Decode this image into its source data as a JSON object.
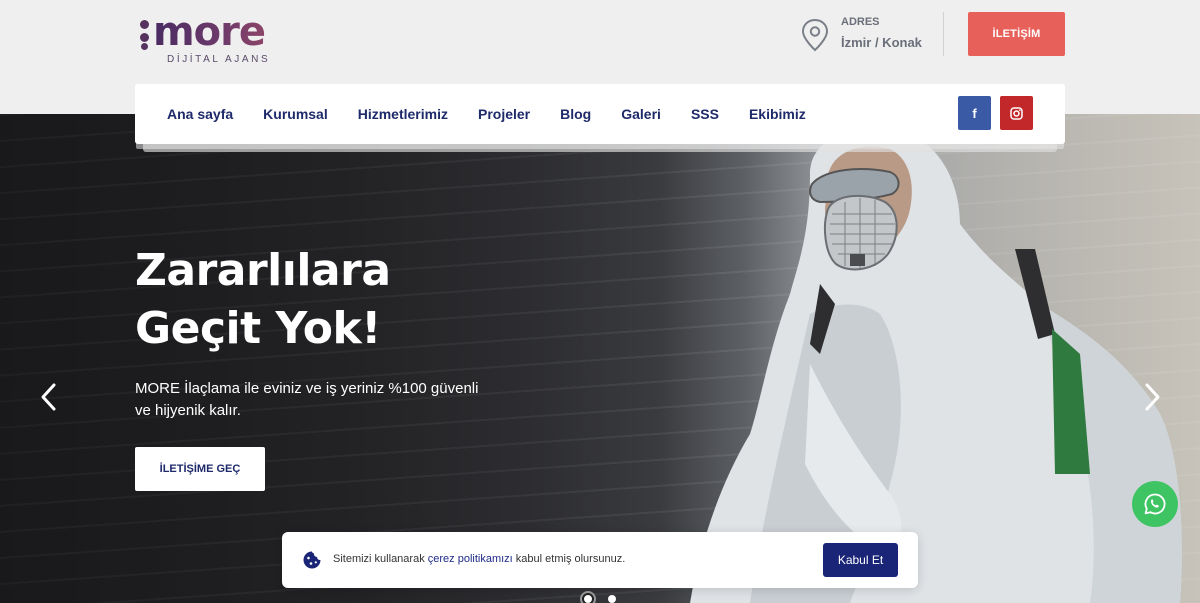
{
  "brand": {
    "name": "more",
    "tagline": "DİJİTAL AJANS"
  },
  "header": {
    "address_label": "ADRES",
    "address_value": "İzmir / Konak",
    "contact_button": "İLETİŞİM"
  },
  "nav": {
    "items": [
      {
        "label": "Ana sayfa"
      },
      {
        "label": "Kurumsal"
      },
      {
        "label": "Hizmetlerimiz"
      },
      {
        "label": "Projeler"
      },
      {
        "label": "Blog"
      },
      {
        "label": "Galeri"
      },
      {
        "label": "SSS"
      },
      {
        "label": "Ekibimiz"
      }
    ],
    "social": [
      {
        "icon": "facebook-icon",
        "glyph": "f"
      },
      {
        "icon": "instagram-icon"
      }
    ]
  },
  "hero": {
    "title_line1": "Zararlılara",
    "title_line2": "Geçit Yok!",
    "text": "MORE İlaçlama ile eviniz ve iş yeriniz %100 güvenli ve hijyenik kalır.",
    "cta": "İLETİŞİME GEÇ",
    "slides_total": 2,
    "slide_active": 1
  },
  "cookie": {
    "text_before": "Sitemizi kullanarak ",
    "link": "çerez politikamızı",
    "text_after": " kabul etmiş olursunuz.",
    "accept": "Kabul Et"
  },
  "colors": {
    "brand_purple": "#56335f",
    "nav_text": "#1e2a6a",
    "contact_red": "#e7615a",
    "facebook": "#3b5aa5",
    "instagram": "#c2282a",
    "whatsapp": "#3fc463",
    "cookie_button": "#1b2578"
  }
}
